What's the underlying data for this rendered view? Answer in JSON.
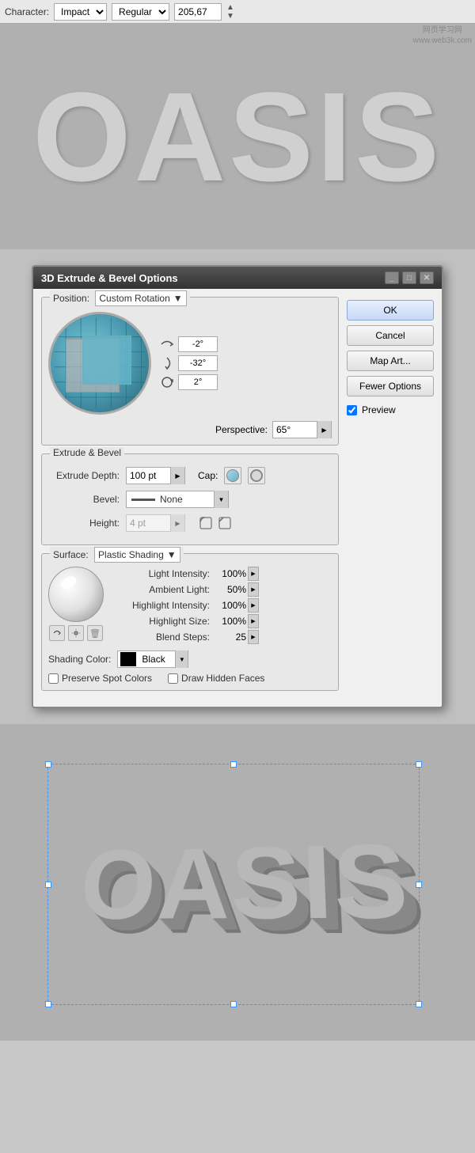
{
  "toolbar": {
    "character_label": "Character:",
    "font_family": "Impact",
    "font_style": "Regular",
    "font_size": "205,67"
  },
  "dialog": {
    "title": "3D Extrude & Bevel Options",
    "position_label": "Position:",
    "position_value": "Custom Rotation",
    "rotation_x": "-2°",
    "rotation_y": "-32°",
    "rotation_z": "2°",
    "perspective_label": "Perspective:",
    "perspective_value": "65°",
    "extrude_bevel_label": "Extrude & Bevel",
    "extrude_depth_label": "Extrude Depth:",
    "extrude_depth_value": "100 pt",
    "cap_label": "Cap:",
    "bevel_label": "Bevel:",
    "bevel_value": "None",
    "height_label": "Height:",
    "height_value": "4 pt",
    "surface_label": "Surface:",
    "surface_value": "Plastic Shading",
    "light_intensity_label": "Light Intensity:",
    "light_intensity_value": "100%",
    "ambient_light_label": "Ambient Light:",
    "ambient_light_value": "50%",
    "highlight_intensity_label": "Highlight Intensity:",
    "highlight_intensity_value": "100%",
    "highlight_size_label": "Highlight Size:",
    "highlight_size_value": "100%",
    "blend_steps_label": "Blend Steps:",
    "blend_steps_value": "25",
    "shading_color_label": "Shading Color:",
    "shading_color_value": "Black",
    "preserve_label": "Preserve Spot Colors",
    "draw_hidden_label": "Draw Hidden Faces",
    "ok_label": "OK",
    "cancel_label": "Cancel",
    "map_art_label": "Map Art...",
    "fewer_options_label": "Fewer Options",
    "preview_label": "Preview"
  },
  "watermark": {
    "line1": "网页学习网",
    "line2": "www.web3k.com"
  },
  "oasis_text": "OASIS"
}
